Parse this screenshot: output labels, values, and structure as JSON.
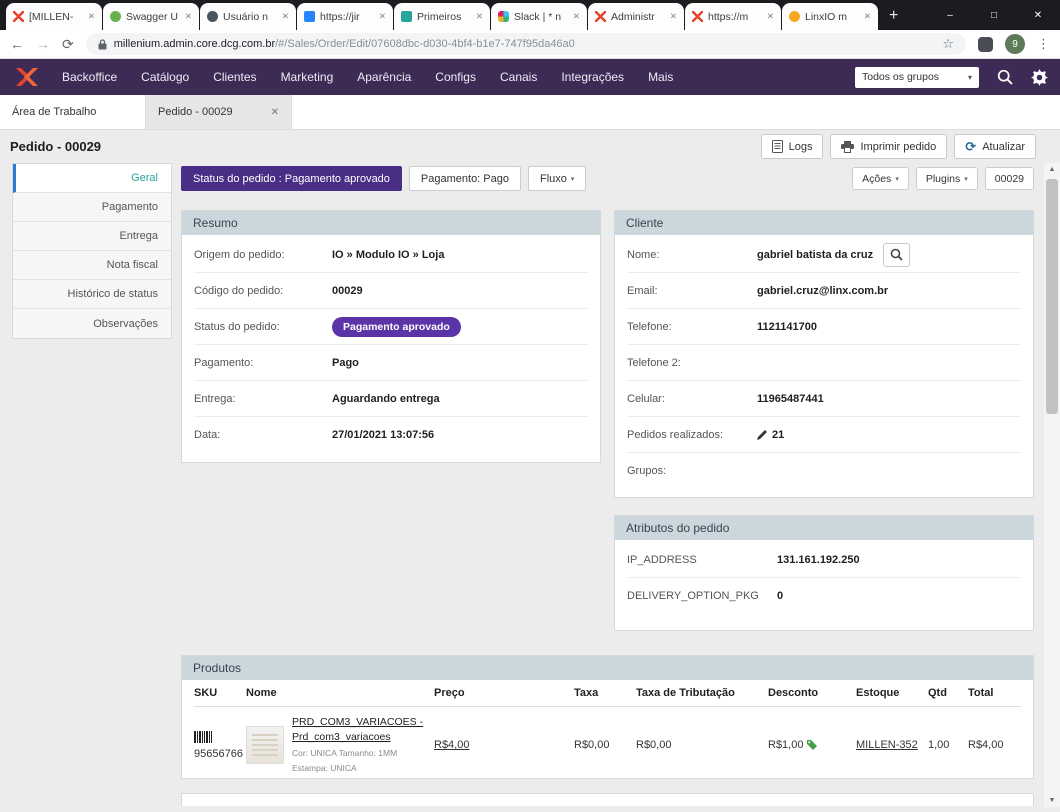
{
  "browser": {
    "tabs": [
      {
        "label": "[MILLEN-"
      },
      {
        "label": "Swagger U"
      },
      {
        "label": "Usuário n"
      },
      {
        "label": "https://jir"
      },
      {
        "label": "Primeiros"
      },
      {
        "label": "Slack | * n"
      },
      {
        "label": "Administr"
      },
      {
        "label": "https://m"
      },
      {
        "label": "LinxIO m"
      }
    ],
    "url_host": "millenium.admin.core.dcg.com.br",
    "url_path": "/#/Sales/Order/Edit/07608dbc-d030-4bf4-b1e7-747f95da46a0",
    "profile_badge": "9"
  },
  "icons": {
    "close": "✕",
    "minimize": "–",
    "maximize": "□",
    "back_arrow": "←",
    "forward_arrow": "→",
    "refresh": "⟳",
    "star": "☆",
    "kebab_menu": "⋮",
    "new_tab_plus": "+",
    "caret_down": "▾",
    "scroll_up": "▲",
    "scroll_down": "▼"
  },
  "app_header": {
    "nav": [
      {
        "label": "Backoffice"
      },
      {
        "label": "Catálogo"
      },
      {
        "label": "Clientes"
      },
      {
        "label": "Marketing"
      },
      {
        "label": "Aparência"
      },
      {
        "label": "Configs"
      },
      {
        "label": "Canais"
      },
      {
        "label": "Integrações"
      },
      {
        "label": "Mais"
      }
    ],
    "group_select_value": "Todos os grupos"
  },
  "workspace_tabs": [
    {
      "label": "Área de Trabalho"
    },
    {
      "label": "Pedido - 00029"
    }
  ],
  "page": {
    "title": "Pedido - 00029",
    "buttons": [
      {
        "label": "Logs"
      },
      {
        "label": "Imprimir pedido"
      },
      {
        "label": "Atualizar"
      }
    ]
  },
  "sidebar": {
    "items": [
      {
        "label": "Geral"
      },
      {
        "label": "Pagamento"
      },
      {
        "label": "Entrega"
      },
      {
        "label": "Nota fiscal"
      },
      {
        "label": "Histórico de status"
      },
      {
        "label": "Observações"
      }
    ]
  },
  "status_bar": {
    "order_status_button": "Status do pedido : Pagamento aprovado",
    "payment_button": "Pagamento: Pago",
    "flow_button": "Fluxo",
    "actions_button": "Ações",
    "plugins_button": "Plugins",
    "order_number_button": "00029"
  },
  "resumo": {
    "title": "Resumo",
    "fields": [
      {
        "label": "Origem do pedido:",
        "value": "IO » Modulo IO » Loja"
      },
      {
        "label": "Código do pedido:",
        "value": "00029"
      },
      {
        "label": "Status do pedido:",
        "value": "Pagamento aprovado"
      },
      {
        "label": "Pagamento:",
        "value": "Pago"
      },
      {
        "label": "Entrega:",
        "value": "Aguardando entrega"
      },
      {
        "label": "Data:",
        "value": "27/01/2021 13:07:56"
      }
    ]
  },
  "cliente": {
    "title": "Cliente",
    "fields": [
      {
        "label": "Nome:",
        "value": "gabriel batista da cruz"
      },
      {
        "label": "Email:",
        "value": "gabriel.cruz@linx.com.br"
      },
      {
        "label": "Telefone:",
        "value": "1121141700"
      },
      {
        "label": "Telefone 2:",
        "value": ""
      },
      {
        "label": "Celular:",
        "value": "11965487441"
      },
      {
        "label": "Pedidos realizados:",
        "value": "21"
      },
      {
        "label": "Grupos:",
        "value": ""
      }
    ]
  },
  "atributos": {
    "title": "Atributos do pedido",
    "fields": [
      {
        "label": "IP_ADDRESS",
        "value": "131.161.192.250"
      },
      {
        "label": "DELIVERY_OPTION_PKG",
        "value": "0"
      }
    ]
  },
  "produtos": {
    "title": "Produtos",
    "columns": [
      "SKU",
      "Nome",
      "Preço",
      "Taxa",
      "Taxa de Tributação",
      "Desconto",
      "Estoque",
      "Qtd",
      "Total"
    ],
    "rows": [
      {
        "sku": "95656766",
        "name_line1": "PRD_COM3_VARIACOES -",
        "name_line2": "Prd_com3_variacoes",
        "variant_line1": "Cor: UNICA Tamanho: 1MM",
        "variant_line2": "Estampa: UNICA",
        "preco": "R$4,00",
        "taxa": "R$0,00",
        "taxa_tributacao": "R$0,00",
        "desconto": "R$1,00",
        "estoque": "MILLEN-352",
        "qtd": "1,00",
        "total": "R$4,00"
      }
    ]
  }
}
